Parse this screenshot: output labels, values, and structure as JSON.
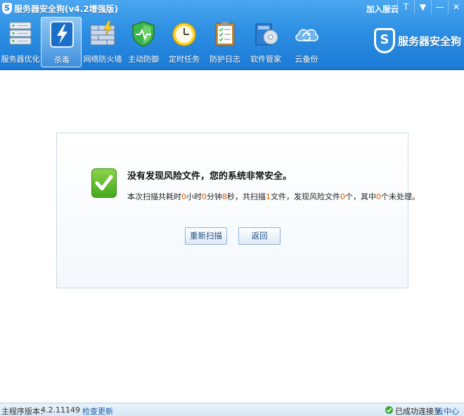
{
  "app": {
    "title": "服务器安全狗(v4.2增强版)",
    "logo_letter": "S"
  },
  "titlebar": {
    "join_label": "加入服云",
    "skin_glyph": "T",
    "menu_glyph": "▼",
    "minimize_glyph": "—",
    "close_glyph": "✕"
  },
  "toolbar": {
    "items": [
      {
        "label": "服务器优化",
        "icon": "server-icon"
      },
      {
        "label": "杀毒",
        "icon": "lightning-icon"
      },
      {
        "label": "网络防火墙",
        "icon": "firewall-icon"
      },
      {
        "label": "主动防御",
        "icon": "shield-icon"
      },
      {
        "label": "定时任务",
        "icon": "clock-icon"
      },
      {
        "label": "防护日志",
        "icon": "clipboard-icon"
      },
      {
        "label": "软件管家",
        "icon": "software-box-icon"
      },
      {
        "label": "云备份",
        "icon": "cloud-sync-icon"
      }
    ],
    "active_index": 1
  },
  "brand": {
    "text": "服务器安全狗",
    "letter": "S"
  },
  "result": {
    "title": "没有发现风险文件，您的系统非常安全。",
    "detail_prefix": "本次扫描共耗时",
    "hours": "0",
    "hours_unit": "小时",
    "minutes": "0",
    "minutes_unit": "分钟",
    "seconds": "8",
    "seconds_unit": "秒，共扫描",
    "scanned": "1",
    "scanned_unit": "文件，发现风险文件",
    "risks": "0",
    "risks_unit": "个，其中",
    "unhandled": "0",
    "unhandled_unit": "个未处理。",
    "rescan_label": "重新扫描",
    "back_label": "返回"
  },
  "status": {
    "version_label": "主程序版本：",
    "version": "4.2.11149",
    "update_label": "检查更新",
    "connection_text": "已成功连接至",
    "cloud_center_label": "云中心"
  },
  "colors": {
    "toolbar_blue": "#2d8fe2",
    "success_green": "#46a81c",
    "highlight_orange": "#e05a00",
    "link_blue": "#1c5ea8"
  }
}
